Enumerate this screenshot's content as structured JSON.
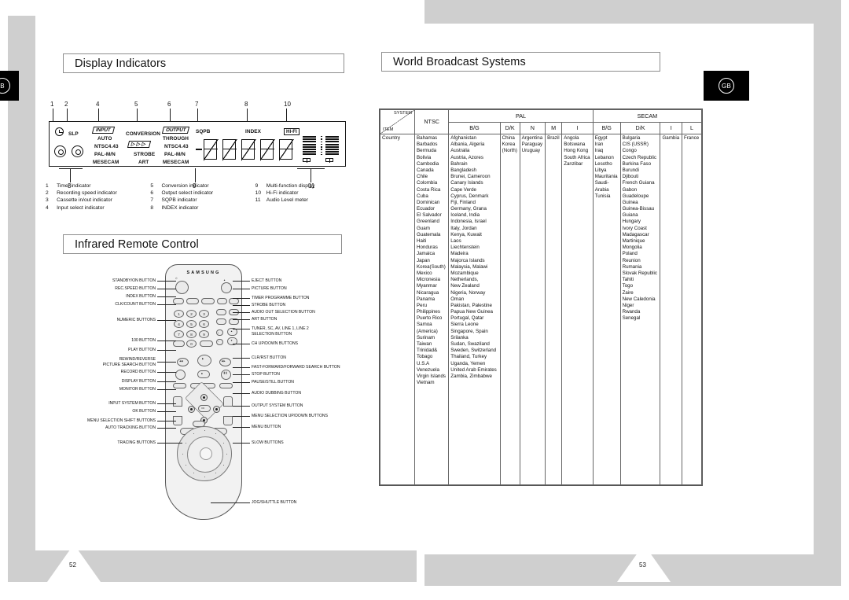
{
  "tabs": {
    "left_label": "B",
    "right_label": "GB"
  },
  "pages": {
    "left_number": "52",
    "right_number": "53"
  },
  "sections": {
    "display_indicators": "Display Indicators",
    "infrared_remote": "Infrared Remote Control",
    "world_broadcast": "World Broadcast Systems"
  },
  "display_panel": {
    "callout_numbers": [
      "1",
      "2",
      "3",
      "4",
      "5",
      "6",
      "7",
      "8",
      "9",
      "10",
      "11"
    ],
    "vfd_labels": {
      "slp": "SLP",
      "input": "INPUT",
      "input_lines": [
        "AUTO",
        "NTSC4.43",
        "PAL-M/N",
        "MESECAM"
      ],
      "conversion": "CONVERSION",
      "conversion_lines": [
        "STROBE",
        "ART"
      ],
      "output": "OUTPUT",
      "output_lines": [
        "THROUGH",
        "NTSC4.43",
        "PAL-M/N",
        "MESECAM"
      ],
      "sqpb": "SQPB",
      "index": "INDEX",
      "hifi": "HI-FI"
    },
    "legend": [
      {
        "num": "1",
        "text": "Timer indicator"
      },
      {
        "num": "2",
        "text": "Recording speed indicator"
      },
      {
        "num": "3",
        "text": "Cassette in/out indicator"
      },
      {
        "num": "4",
        "text": "Input select indicator"
      },
      {
        "num": "5",
        "text": "Conversion indicator"
      },
      {
        "num": "6",
        "text": "Output select indicator"
      },
      {
        "num": "7",
        "text": "SQPB indicator"
      },
      {
        "num": "8",
        "text": "INDEX indicator"
      },
      {
        "num": "9",
        "text": "Multi-function display"
      },
      {
        "num": "10",
        "text": "Hi-Fi indicator"
      },
      {
        "num": "11",
        "text": "Audio Level meter"
      }
    ]
  },
  "remote": {
    "brand": "SAMSUNG",
    "left_labels": [
      "STANDBY/ON BUTTON",
      "REC.SPEED BUTTON",
      "INDEX BUTTON",
      "CLK/COUNT BUTTON",
      "NUMERIC BUTTONS",
      "100 BUTTON",
      "PLAY BUTTON",
      "REWIND/REVERSE",
      "PICTURE SEARCH BUTTON",
      "RECORD BUTTON",
      "DISPLAY BUTTON",
      "MONITOR BUTTON",
      "INPUT SYSTEM BUTTON",
      "OK BUTTON",
      "MENU SELECTION SHIFT BUTTONS",
      "AUTO TRACKING BUTTON",
      "TRACING BUTTONS"
    ],
    "right_labels": [
      "EJECT BUTTON",
      "PICTURE BUTTON",
      "TIMER PROGRAMME BUTTON",
      "STROBE BUTTON",
      "AUDIO OUT SELECTION BUTTON",
      "ART BUTTON",
      "TUNER, SC, AV, LINE 1, LINE 2",
      "SELECTION  BUTTON",
      "CH UP/DOWN BUTTONS",
      "CLR/RST BUTTON",
      "FAST-FORWARD/FORWARD SEARCH BUTTON",
      "STOP BUTTON",
      "PAUSE/STILL BUTTON",
      "AUDIO DUBBING BUTTON",
      "OUTPUT SYSTEM BUTTON",
      "MENU SELECTION UP/DOWN BUTTONS",
      "MENU BUTTON",
      "SLOW BUTTONS",
      "JOG/SHUTTLE BUTTON"
    ],
    "numeric_keys": [
      "1",
      "2",
      "3",
      "4",
      "5",
      "6",
      "7",
      "8",
      "9",
      "0"
    ]
  },
  "world_table": {
    "corner": {
      "system": "SYSTEM",
      "item": "ITEM"
    },
    "groups": [
      {
        "name": "NTSC",
        "span": 1
      },
      {
        "name": "PAL",
        "span": 5
      },
      {
        "name": "SECAM",
        "span": 4
      }
    ],
    "subheaders": [
      "B/G",
      "D/K",
      "N",
      "M",
      "I",
      "B/G",
      "D/K",
      "I",
      "L"
    ],
    "row_label": "Country",
    "columns": {
      "ntsc": [
        "Bahamas",
        "Barbados",
        "Bermuda",
        "Bolivia",
        "Cambodia",
        "Canada",
        "Chile",
        "Colombia",
        "Costa Rica",
        "Cuba",
        "Dominican",
        "Ecuador",
        "El Salvador",
        "Greenland",
        "Guam",
        "Guatemala",
        "Haiti",
        "Honduras",
        "Jamaica",
        "Japan",
        "Korea(South)",
        "Mexico",
        "Micronesia",
        "Myanmar",
        "Nicaragua",
        "Panama",
        "Peru",
        "Philippines",
        "Puerto Rico",
        "Samoa",
        "(America)",
        "Surinam",
        "Taiwan",
        "Trinidad&",
        "Tobago",
        "U.S.A",
        "Venezuela",
        "Virgin Islands",
        "Vietnam"
      ],
      "pal_bg": [
        "Afghanistan",
        "Albania, Algeria",
        "Australia",
        "Austria, Azores",
        "Bahrain",
        "Bangladesh",
        "Brunei, Cameroon",
        "Canary Islands",
        "Cape Verde",
        "Cyprus, Denmark",
        "Fiji, Finland",
        "Germany, Grana",
        "Iceland, India",
        "Indonesia, Israel",
        "Italy, Jordan",
        "Kenya, Kuwait",
        "Laos",
        "Liechtenstein",
        "Madeira",
        "Majorca  Islands",
        "Malaysia, Malawi",
        "Mozambique",
        "Netherlands,",
        "New Zealand",
        "Nigeria, Norway",
        "Oman",
        "Pakistan, Palestine",
        "Papua New Guinea",
        "Portugal, Qatar",
        "Sierra Leone",
        "Singapore, Spain",
        "Srilanka",
        "Sudan, Swaziland",
        "Sweden, Switzerland",
        "Thailand, Turkey",
        "Uganda, Yemen",
        "United Arab Emirates",
        "Zambia, Zimbabwe"
      ],
      "pal_dk": [
        "China",
        "Korea",
        "(North)"
      ],
      "pal_n": [
        "Argentina",
        "Paraguay",
        "Uruguay"
      ],
      "pal_m": [
        "Brazil"
      ],
      "pal_i": [
        "Angola",
        "Botswana",
        "Hong Kong",
        "South Africa",
        "Zanzibar"
      ],
      "secam_bg": [
        "Egypt",
        "Iran",
        "Iraq",
        "Lebanon",
        "Lesotho",
        "Libya",
        "Mauritania",
        "Saudi-",
        "Arabia",
        "Tunisia"
      ],
      "secam_dk": [
        "Bulgaria",
        "CIS (USSR)",
        "Congo",
        "Czech  Republic",
        "Burkina Faso",
        "Burundi",
        "Djibouti",
        "French Guiana",
        "Gabon",
        "Guadeloupe",
        "Guinea",
        "Guinea-Bissau",
        "Guiana",
        "Hungary",
        "Ivory Coast",
        "Madagascar",
        "Martinique",
        "Mongolia",
        "Poland",
        "Reunion",
        "Rumania",
        "Slovak Republic",
        "Tahiti",
        "Togo",
        "Zaire",
        "New Caledonia",
        "Niger",
        "Rwanda",
        "Senegal"
      ],
      "secam_i": [
        "Gambia"
      ],
      "secam_l": [
        "France"
      ]
    }
  }
}
